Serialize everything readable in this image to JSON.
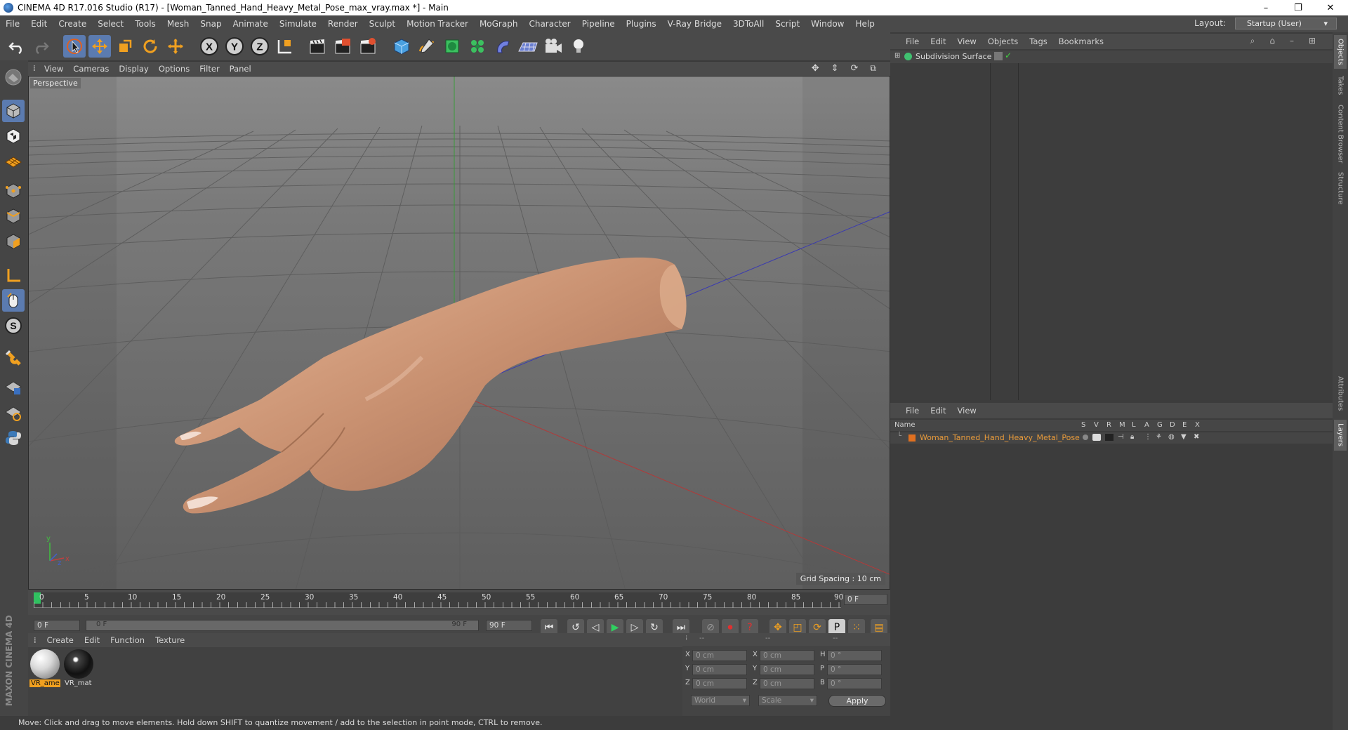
{
  "window": {
    "title": "CINEMA 4D R17.016 Studio (R17) - [Woman_Tanned_Hand_Heavy_Metal_Pose_max_vray.max *] - Main",
    "controls": [
      "–",
      "❐",
      "✕"
    ]
  },
  "menubar": {
    "items": [
      "File",
      "Edit",
      "Create",
      "Select",
      "Tools",
      "Mesh",
      "Snap",
      "Animate",
      "Simulate",
      "Render",
      "Sculpt",
      "Motion Tracker",
      "MoGraph",
      "Character",
      "Pipeline",
      "Plugins",
      "V-Ray Bridge",
      "3DToAll",
      "Script",
      "Window",
      "Help"
    ],
    "layout_label": "Layout:",
    "layout_value": "Startup (User)"
  },
  "toolbar": {
    "axis_x": "X",
    "axis_y": "Y",
    "axis_z": "Z"
  },
  "viewport": {
    "menu": [
      "View",
      "Cameras",
      "Display",
      "Options",
      "Filter",
      "Panel"
    ],
    "camera_label": "Perspective",
    "grid_spacing": "Grid Spacing : 10 cm",
    "axis_labels": [
      "y",
      "x",
      "z"
    ]
  },
  "timeline": {
    "ticks": [
      "0",
      "5",
      "10",
      "15",
      "20",
      "25",
      "30",
      "35",
      "40",
      "45",
      "50",
      "55",
      "60",
      "65",
      "70",
      "75",
      "80",
      "85",
      "90"
    ],
    "current_frame": "0 F"
  },
  "transport": {
    "start_field": "0 F",
    "range_start": "0 F",
    "range_end": "90 F",
    "end_field": "90 F"
  },
  "materials": {
    "menu": [
      "Create",
      "Edit",
      "Function",
      "Texture"
    ],
    "items": [
      {
        "label": "VR_ame"
      },
      {
        "label": "VR_mat"
      }
    ]
  },
  "coordinates": {
    "headers": [
      "--",
      "--",
      "--"
    ],
    "rows": [
      {
        "a": "X",
        "av": "0 cm",
        "b": "X",
        "bv": "0 cm",
        "c": "H",
        "cv": "0 °"
      },
      {
        "a": "Y",
        "av": "0 cm",
        "b": "Y",
        "bv": "0 cm",
        "c": "P",
        "cv": "0 °"
      },
      {
        "a": "Z",
        "av": "0 cm",
        "b": "Z",
        "bv": "0 cm",
        "c": "B",
        "cv": "0 °"
      }
    ],
    "world": "World",
    "scale": "Scale",
    "apply": "Apply"
  },
  "status": "Move: Click and drag to move elements. Hold down SHIFT to quantize movement / add to the selection in point mode, CTRL to remove.",
  "brand": "MAXON CINEMA 4D",
  "objects": {
    "menu": [
      "File",
      "Edit",
      "View",
      "Objects",
      "Tags",
      "Bookmarks"
    ],
    "items": [
      {
        "name": "Subdivision Surface"
      }
    ]
  },
  "layers": {
    "menu": [
      "File",
      "Edit",
      "View"
    ],
    "header_name": "Name",
    "columns": [
      "S",
      "V",
      "R",
      "M",
      "L",
      "A",
      "G",
      "D",
      "E",
      "X"
    ],
    "items": [
      {
        "name": "Woman_Tanned_Hand_Heavy_Metal_Pose",
        "color": "#e07020"
      }
    ]
  },
  "side_tabs": [
    "Objects",
    "Takes",
    "Content Browser",
    "Structure",
    "Attributes",
    "Layers"
  ],
  "colors": {
    "accent": "#5b7bb0",
    "layer_text": "#e89a3a"
  }
}
